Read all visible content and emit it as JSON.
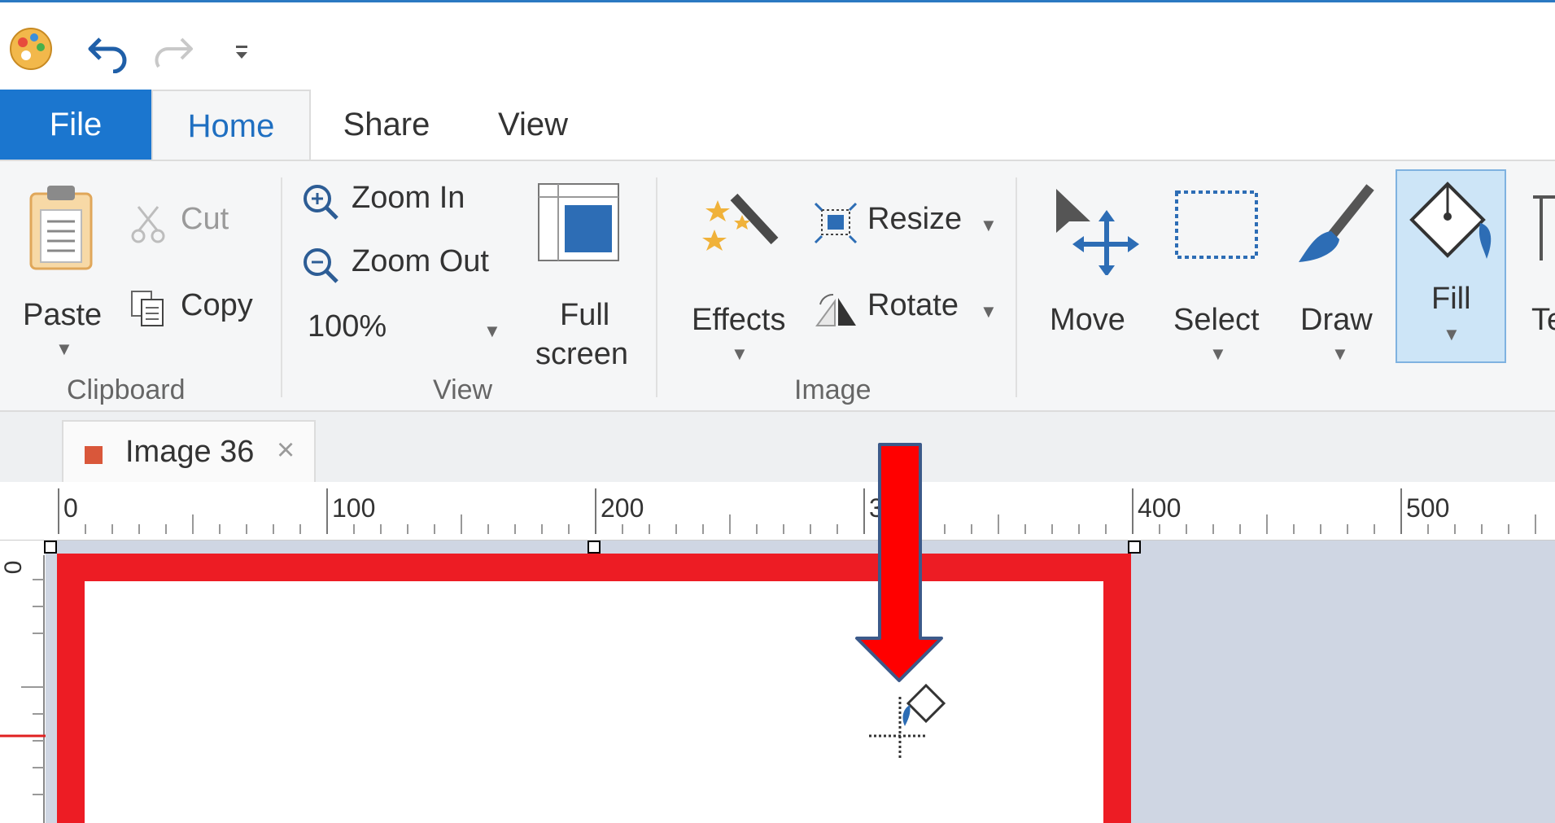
{
  "window": {
    "accent": "#2b79c2"
  },
  "qat": {
    "icons": [
      "paint-palette-icon",
      "undo-icon",
      "redo-icon",
      "customize-qat-icon"
    ]
  },
  "tabs": {
    "file": "File",
    "home": "Home",
    "share": "Share",
    "view": "View"
  },
  "ribbon": {
    "clipboard": {
      "paste": "Paste",
      "cut": "Cut",
      "copy": "Copy",
      "group": "Clipboard"
    },
    "view": {
      "zoom_in": "Zoom In",
      "zoom_out": "Zoom Out",
      "zoom_level": "100%",
      "full_screen_1": "Full",
      "full_screen_2": "screen",
      "group": "View"
    },
    "image": {
      "effects": "Effects",
      "resize": "Resize",
      "rotate": "Rotate",
      "group": "Image"
    },
    "tools": {
      "move": "Move",
      "select": "Select",
      "draw": "Draw",
      "fill": "Fill",
      "text_partial": "Te"
    }
  },
  "document": {
    "tab_title": "Image 36",
    "tab_color": "#d9573a",
    "close": "×"
  },
  "ruler": {
    "h_labels": [
      "0",
      "100",
      "200",
      "3",
      "400",
      "500"
    ],
    "v_label": "0"
  },
  "canvas": {
    "border_color": "#ed1c24",
    "background": "#cfd6e3"
  },
  "annotation": {
    "arrow_color": "#ff0000"
  }
}
